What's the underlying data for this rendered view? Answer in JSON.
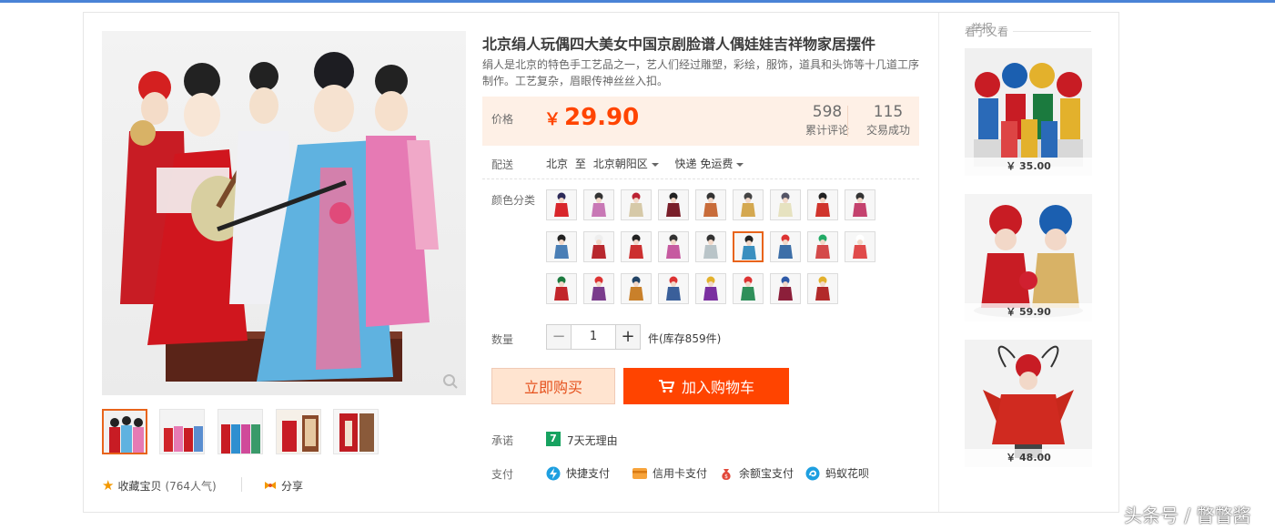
{
  "report_link": "举报",
  "product": {
    "title": "北京绢人玩偶四大美女中国京剧脸谱人偶娃娃吉祥物家居摆件",
    "subtitle": "绢人是北京的特色手工艺品之一，艺人们经过雕塑，彩绘，服饰，道具和头饰等十几道工序制作。工艺复杂，眉眼传神丝丝入扣。"
  },
  "price": {
    "label": "价格",
    "currency": "￥",
    "value": "29.90",
    "reviews_count": "598",
    "reviews_label": "累计评论",
    "deals_count": "115",
    "deals_label": "交易成功"
  },
  "shipping": {
    "label": "配送",
    "from": "北京",
    "to_word": "至",
    "to": "北京朝阳区",
    "method": "快递 免运费"
  },
  "color": {
    "label": "颜色分类",
    "selected_index": 14,
    "swatches": [
      {
        "bg": "#d8262b",
        "accent": "#2d2a58"
      },
      {
        "bg": "#c878b5",
        "accent": "#333"
      },
      {
        "bg": "#d6c9a8",
        "accent": "#b23"
      },
      {
        "bg": "#7a1f2a",
        "accent": "#222"
      },
      {
        "bg": "#c86c3a",
        "accent": "#333"
      },
      {
        "bg": "#d4a850",
        "accent": "#444"
      },
      {
        "bg": "#e6e2c0",
        "accent": "#556"
      },
      {
        "bg": "#d0342c",
        "accent": "#222"
      },
      {
        "bg": "#c4426e",
        "accent": "#333"
      },
      {
        "bg": "#4a7fb6",
        "accent": "#222"
      },
      {
        "bg": "#b8282e",
        "accent": "#eee"
      },
      {
        "bg": "#cc3030",
        "accent": "#222"
      },
      {
        "bg": "#c65aa0",
        "accent": "#333"
      },
      {
        "bg": "#b9c4c8",
        "accent": "#333"
      },
      {
        "bg": "#3a8fbf",
        "accent": "#222"
      },
      {
        "bg": "#3d6fa8",
        "accent": "#d33"
      },
      {
        "bg": "#d44a4a",
        "accent": "#2a6"
      },
      {
        "bg": "#e04a4a",
        "accent": "#fff"
      },
      {
        "bg": "#c2262b",
        "accent": "#1b7a3e"
      },
      {
        "bg": "#7a3c8c",
        "accent": "#d33"
      },
      {
        "bg": "#c9802a",
        "accent": "#246"
      },
      {
        "bg": "#3a5f9a",
        "accent": "#d33"
      },
      {
        "bg": "#7a2fa0",
        "accent": "#e3b12c"
      },
      {
        "bg": "#2f8f5a",
        "accent": "#d33"
      },
      {
        "bg": "#8c1f3a",
        "accent": "#2e5aa8"
      },
      {
        "bg": "#b22a2a",
        "accent": "#e3b12c"
      }
    ]
  },
  "quantity": {
    "label": "数量",
    "minus": "−",
    "value": "1",
    "plus": "+",
    "stock": "件(库存859件)"
  },
  "actions": {
    "buy_now": "立即购买",
    "add_to_cart": "加入购物车"
  },
  "promise": {
    "label": "承诺",
    "icon_text": "7",
    "text": "7天无理由"
  },
  "payment": {
    "label": "支付",
    "methods": [
      "快捷支付",
      "信用卡支付",
      "余额宝支付",
      "蚂蚁花呗"
    ]
  },
  "gallery": {
    "selected_index": 0
  },
  "favorite": {
    "label": "收藏宝贝",
    "popularity": "(764人气)"
  },
  "share": {
    "label": "分享"
  },
  "also_viewed": {
    "label": "看了又看",
    "items": [
      {
        "price": "￥ 35.00"
      },
      {
        "price": "￥ 59.90"
      },
      {
        "price": "￥ 48.00"
      }
    ]
  },
  "watermark": "头条号 / 瞥瞥酱",
  "colors": {
    "accent": "#ff4400",
    "price_bg": "#fef0e6",
    "top_bar": "#4a83d6"
  }
}
